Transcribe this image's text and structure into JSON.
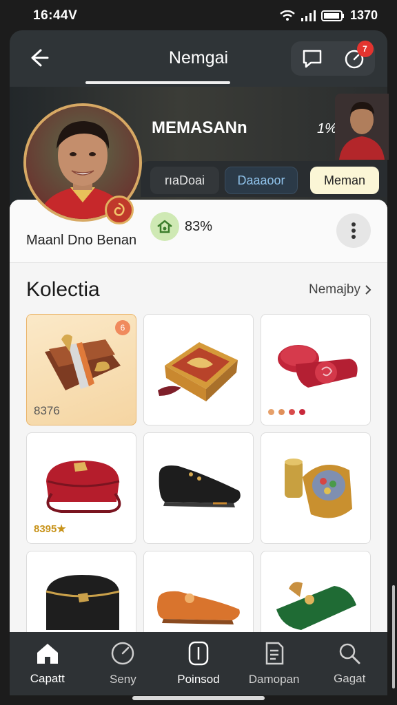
{
  "status_bar": {
    "time": "16:44V",
    "battery": "1370"
  },
  "header": {
    "title": "Nemgai",
    "notification_count": "7"
  },
  "hero": {
    "title": "MEMASANn",
    "percent": "1%",
    "tabs": [
      "rıaDoai",
      "Daaaoor",
      "Meman"
    ]
  },
  "profile": {
    "name": "Maanl Dno Benan",
    "stat": "83%"
  },
  "collection": {
    "title": "Kolectia",
    "see_all": "Nemajby",
    "items": [
      {
        "name": "brown-wallet",
        "price": "8376",
        "badge": "6"
      },
      {
        "name": "ornate-box"
      },
      {
        "name": "red-wallet"
      },
      {
        "name": "red-bag",
        "rating": "8395★"
      },
      {
        "name": "black-shoe"
      },
      {
        "name": "gold-cans"
      },
      {
        "name": "black-bag"
      },
      {
        "name": "orange-shoe"
      },
      {
        "name": "green-wallet"
      }
    ]
  },
  "bottom_nav": {
    "items": [
      {
        "label": "Capatt",
        "icon": "home-icon"
      },
      {
        "label": "Seny",
        "icon": "compass-icon"
      },
      {
        "label": "Poinsod",
        "icon": "card-icon"
      },
      {
        "label": "Damopan",
        "icon": "document-icon"
      },
      {
        "label": "Gagat",
        "icon": "search-icon"
      }
    ]
  },
  "colors": {
    "accent_gold": "#d7a964",
    "badge_red": "#e3342f",
    "highlight_card": "#f5d5a2"
  }
}
